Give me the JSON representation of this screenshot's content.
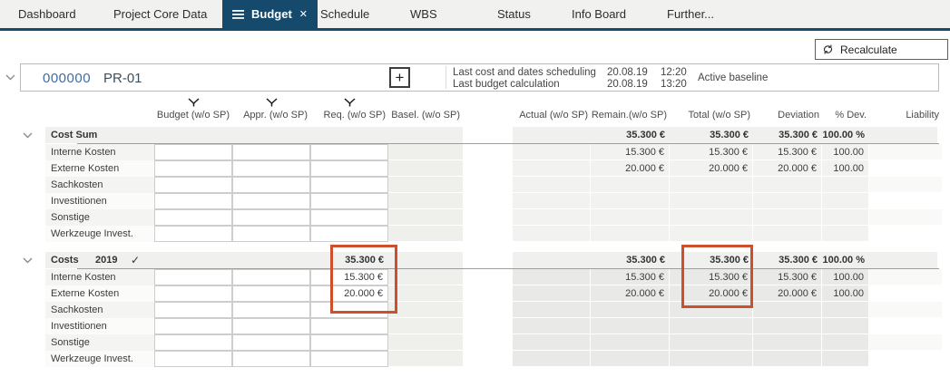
{
  "nav": {
    "tabs": [
      {
        "label": "Dashboard",
        "active": false
      },
      {
        "label": "Project Core Data",
        "active": false
      },
      {
        "label": "Budget",
        "active": true
      },
      {
        "label": "Schedule",
        "active": false
      },
      {
        "label": "WBS",
        "active": false
      },
      {
        "label": "Status",
        "active": false
      },
      {
        "label": "Info Board",
        "active": false
      },
      {
        "label": "Further...",
        "active": false
      }
    ]
  },
  "toolbar": {
    "recalculate_label": "Recalculate"
  },
  "project": {
    "id": "000000",
    "code": "PR-01",
    "scheduling_label": "Last cost and dates scheduling",
    "scheduling_date": "20.08.19",
    "scheduling_time": "12:20",
    "budget_label": "Last budget calculation",
    "budget_date": "20.08.19",
    "budget_time": "13:20",
    "baseline": "Active baseline"
  },
  "columns": {
    "budget": "Budget (w/o SP)",
    "appr": "Appr. (w/o SP)",
    "req": "Req. (w/o SP)",
    "basel": "Basel. (w/o SP)",
    "actual": "Actual (w/o SP)",
    "remain": "Remain.(w/o SP)",
    "total": "Total (w/o SP)",
    "deviation": "Deviation",
    "pct": "% Dev.",
    "liability": "Liability"
  },
  "groups": [
    {
      "title": "Cost Sum",
      "year": "",
      "checked": false,
      "summary": {
        "req": "",
        "remain": "35.300 €",
        "total": "35.300 €",
        "deviation": "35.300 €",
        "pct": "100.00 %"
      },
      "rows": [
        {
          "label": "Interne Kosten",
          "req": "",
          "remain": "15.300 €",
          "total": "15.300 €",
          "deviation": "15.300 €",
          "pct": "100.00 %"
        },
        {
          "label": "Externe Kosten",
          "req": "",
          "remain": "20.000 €",
          "total": "20.000 €",
          "deviation": "20.000 €",
          "pct": "100.00 %"
        },
        {
          "label": "Sachkosten",
          "req": "",
          "remain": "",
          "total": "",
          "deviation": "",
          "pct": ""
        },
        {
          "label": "Investitionen",
          "req": "",
          "remain": "",
          "total": "",
          "deviation": "",
          "pct": ""
        },
        {
          "label": "Sonstige",
          "req": "",
          "remain": "",
          "total": "",
          "deviation": "",
          "pct": ""
        },
        {
          "label": "Werkzeuge Invest.",
          "req": "",
          "remain": "",
          "total": "",
          "deviation": "",
          "pct": ""
        }
      ]
    },
    {
      "title": "Costs",
      "year": "2019",
      "checked": true,
      "summary": {
        "req": "35.300 €",
        "remain": "35.300 €",
        "total": "35.300 €",
        "deviation": "35.300 €",
        "pct": "100.00 %"
      },
      "rows": [
        {
          "label": "Interne Kosten",
          "req": "15.300 €",
          "remain": "15.300 €",
          "total": "15.300 €",
          "deviation": "15.300 €",
          "pct": "100.00 %"
        },
        {
          "label": "Externe Kosten",
          "req": "20.000 €",
          "remain": "20.000 €",
          "total": "20.000 €",
          "deviation": "20.000 €",
          "pct": "100.00 %"
        },
        {
          "label": "Sachkosten",
          "req": "",
          "remain": "",
          "total": "",
          "deviation": "",
          "pct": ""
        },
        {
          "label": "Investitionen",
          "req": "",
          "remain": "",
          "total": "",
          "deviation": "",
          "pct": ""
        },
        {
          "label": "Sonstige",
          "req": "",
          "remain": "",
          "total": "",
          "deviation": "",
          "pct": ""
        },
        {
          "label": "Werkzeuge Invest.",
          "req": "",
          "remain": "",
          "total": "",
          "deviation": "",
          "pct": ""
        }
      ]
    }
  ],
  "colors": {
    "accent": "#154a6d",
    "highlight": "#cf4e2b"
  }
}
